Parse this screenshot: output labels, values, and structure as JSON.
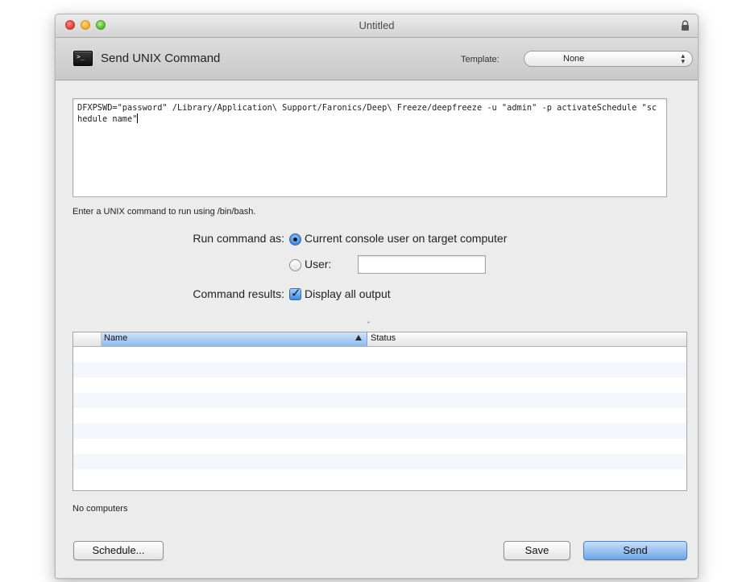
{
  "window": {
    "title": "Untitled"
  },
  "header": {
    "title": "Send UNIX Command",
    "template_label": "Template:",
    "template_value": "None"
  },
  "command": {
    "text": "DFXPSWD=\"password\" /Library/Application\\ Support/Faronics/Deep\\ Freeze/deepfreeze -u \"admin\" -p activateSchedule \"schedule name\"",
    "hint": "Enter a UNIX command to run using /bin/bash."
  },
  "run_as": {
    "label": "Run command as:",
    "option_console": "Current console user on target computer",
    "option_user": "User:",
    "user_value": "",
    "selected": "console"
  },
  "results": {
    "label": "Command results:",
    "option_display": "Display all output",
    "checked": true
  },
  "table": {
    "columns": [
      "Name",
      "Status"
    ],
    "sort_column": "Name",
    "rows": []
  },
  "footer": {
    "status": "No computers",
    "schedule_button": "Schedule...",
    "save_button": "Save",
    "send_button": "Send"
  }
}
